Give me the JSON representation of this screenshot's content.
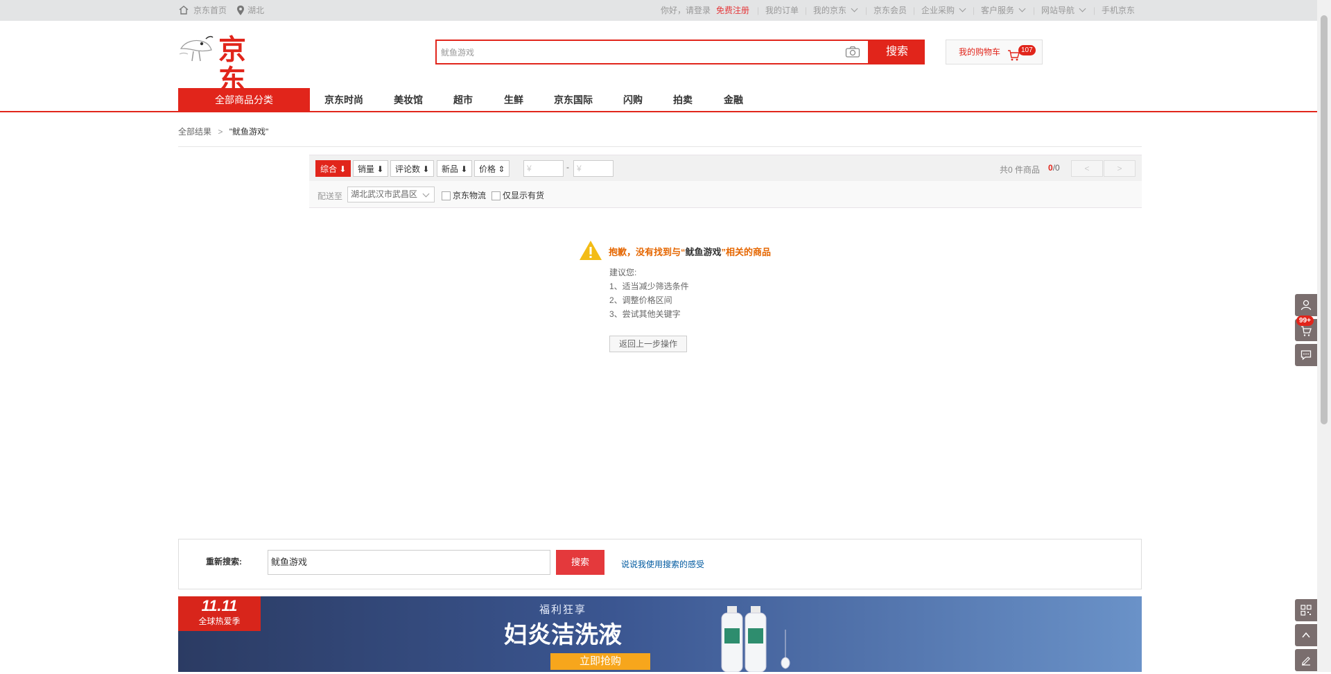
{
  "topbar": {
    "home_label": "京东首页",
    "location": "湖北",
    "greeting": "你好，请登录",
    "register": "免费注册",
    "my_orders": "我的订单",
    "my_jd": "我的京东",
    "jd_member": "京东会员",
    "enterprise": "企业采购",
    "customer_service": "客户服务",
    "site_nav": "网站导航",
    "mobile_jd": "手机京东"
  },
  "header": {
    "logo_text": "京东",
    "search_value": "鱿鱼游戏",
    "search_button": "搜索",
    "cart_label": "我的购物车",
    "cart_count": "107"
  },
  "nav": {
    "all_categories": "全部商品分类",
    "items": [
      "京东时尚",
      "美妆馆",
      "超市",
      "生鲜",
      "京东国际",
      "闪购",
      "拍卖",
      "金融"
    ]
  },
  "breadcrumb": {
    "root": "全部结果",
    "sep": ">",
    "query": "\"鱿鱼游戏\""
  },
  "filter": {
    "sort": [
      "综合",
      "销量",
      "评论数",
      "新品",
      "价格"
    ],
    "price_placeholder": "¥",
    "price_dash": "-",
    "total_label": "共0 件商品",
    "page_current": "0",
    "page_total": "/0",
    "deliver_label": "配送至",
    "deliver_value": "湖北武汉市武昌区",
    "jd_logistics": "京东物流",
    "in_stock": "仅显示有货"
  },
  "notice": {
    "prefix": "抱歉，没有找到与“",
    "query": "鱿鱼游戏",
    "suffix": "”相关的商品",
    "suggest_title": "建议您:",
    "suggestions": [
      "1、适当减少筛选条件",
      "2、调整价格区间",
      "3、尝试其他关键字"
    ],
    "back_button": "返回上一步操作"
  },
  "research": {
    "label": "重新搜索:",
    "value": "鱿鱼游戏",
    "button": "搜索",
    "feedback_link": "说说我使用搜索的感受"
  },
  "banner": {
    "badge_logo": "11.11",
    "badge_text": "全球热爱季",
    "kicker": "福利狂享",
    "headline": "妇炎洁洗液",
    "cta": "立即抢购"
  },
  "sidebar": {
    "cart_badge": "99+"
  },
  "colors": {
    "brand_red": "#e1251b",
    "notice_orange": "#e56600",
    "link_blue": "#005aa0"
  },
  "icons": [
    "home-icon",
    "location-pin-icon",
    "camera-icon",
    "cart-icon",
    "warning-icon",
    "user-icon",
    "chat-icon",
    "qrcode-icon",
    "arrow-up-icon",
    "edit-icon"
  ]
}
